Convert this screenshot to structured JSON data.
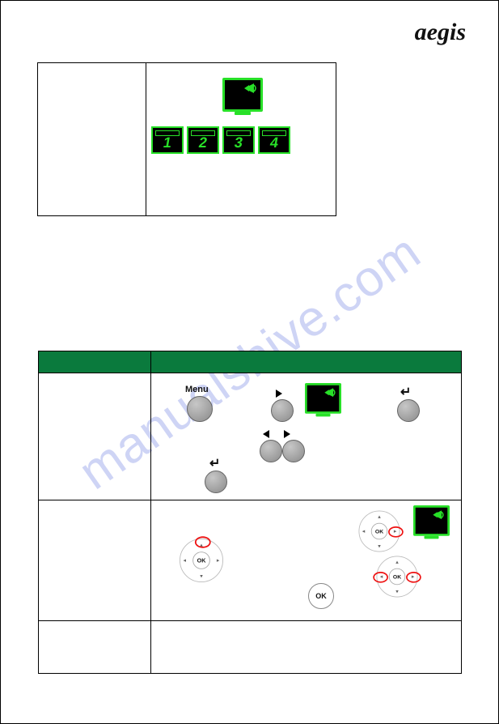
{
  "brand": "aegis",
  "watermark": "manualshive.com",
  "chips": {
    "n1": "1",
    "n2": "2",
    "n3": "3",
    "n4": "4"
  },
  "labels": {
    "menu": "Menu",
    "ok": "OK"
  }
}
